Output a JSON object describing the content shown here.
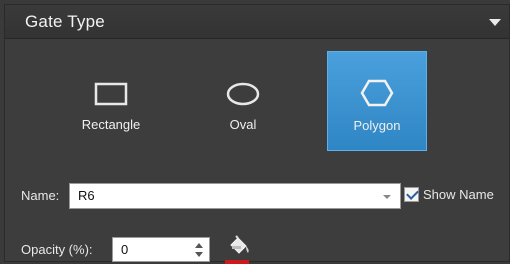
{
  "panel": {
    "title": "Gate Type",
    "collapse_icon": "triangle-down-icon"
  },
  "gate_types": [
    {
      "label": "Rectangle",
      "icon": "rectangle-icon",
      "selected": false
    },
    {
      "label": "Oval",
      "icon": "oval-icon",
      "selected": false
    },
    {
      "label": "Polygon",
      "icon": "hexagon-icon",
      "selected": true
    }
  ],
  "name_field": {
    "label": "Name:",
    "value": "R6"
  },
  "show_name": {
    "label": "Show Name",
    "checked": true
  },
  "opacity": {
    "label": "Opacity (%):",
    "value": "0"
  },
  "colors": {
    "accent": "#3a8fcf",
    "fill_color": "#cc1a1a",
    "panel_bg": "#3d3d3d"
  }
}
